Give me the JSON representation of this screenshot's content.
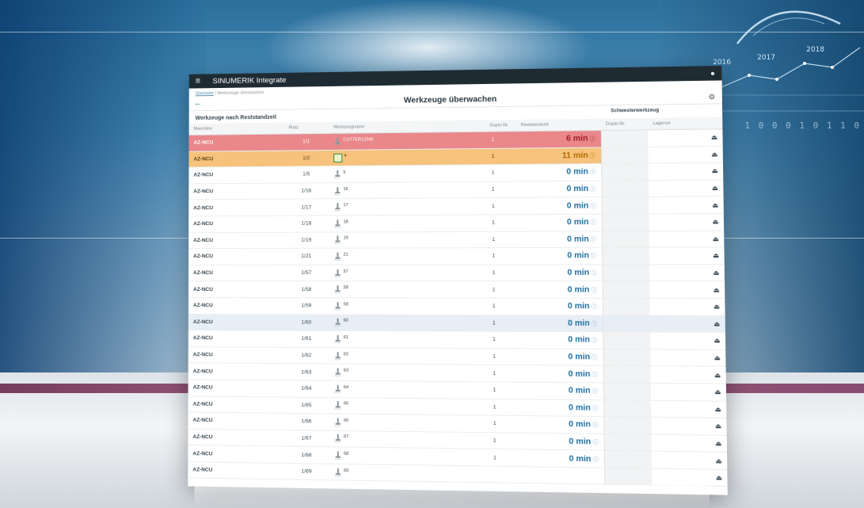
{
  "app": {
    "title": "SINUMERIK Integrate"
  },
  "breadcrumb": {
    "home": "Startseite",
    "separator": "|",
    "current": "Werkzeuge überwachen"
  },
  "page": {
    "title": "Werkzeuge überwachen"
  },
  "section": {
    "title": "Werkzeuge nach Reststandzeit",
    "sister_title": "Schwesterwerkzeug"
  },
  "columns": {
    "machine": "Maschine",
    "place": "Platz",
    "tool_name": "Werkzeugname",
    "duplo": "Duplo-Nr.",
    "rest": "Reststandzeit",
    "sister_duplo": "Duplo-Nr.",
    "location": "Lagerort"
  },
  "rows": [
    {
      "machine": "AZ-NCU",
      "place": "1/1",
      "tool": "CUTTER12345",
      "duplo": "1",
      "rest": "6 min",
      "status": "critical"
    },
    {
      "machine": "AZ-NCU",
      "place": "1/2",
      "tool": "4",
      "duplo": "1",
      "rest": "11 min",
      "status": "warning"
    },
    {
      "machine": "AZ-NCU",
      "place": "1/5",
      "tool": "5",
      "duplo": "1",
      "rest": "0 min",
      "status": "normal"
    },
    {
      "machine": "AZ-NCU",
      "place": "1/16",
      "tool": "16",
      "duplo": "1",
      "rest": "0 min",
      "status": "normal"
    },
    {
      "machine": "AZ-NCU",
      "place": "1/17",
      "tool": "17",
      "duplo": "1",
      "rest": "0 min",
      "status": "normal"
    },
    {
      "machine": "AZ-NCU",
      "place": "1/18",
      "tool": "18",
      "duplo": "1",
      "rest": "0 min",
      "status": "normal"
    },
    {
      "machine": "AZ-NCU",
      "place": "1/19",
      "tool": "19",
      "duplo": "1",
      "rest": "0 min",
      "status": "normal"
    },
    {
      "machine": "AZ-NCU",
      "place": "1/21",
      "tool": "21",
      "duplo": "1",
      "rest": "0 min",
      "status": "normal"
    },
    {
      "machine": "AZ-NCU",
      "place": "1/57",
      "tool": "57",
      "duplo": "1",
      "rest": "0 min",
      "status": "normal"
    },
    {
      "machine": "AZ-NCU",
      "place": "1/58",
      "tool": "58",
      "duplo": "1",
      "rest": "0 min",
      "status": "normal"
    },
    {
      "machine": "AZ-NCU",
      "place": "1/59",
      "tool": "59",
      "duplo": "1",
      "rest": "0 min",
      "status": "normal"
    },
    {
      "machine": "AZ-NCU",
      "place": "1/60",
      "tool": "60",
      "duplo": "1",
      "rest": "0 min",
      "status": "selected"
    },
    {
      "machine": "AZ-NCU",
      "place": "1/61",
      "tool": "61",
      "duplo": "1",
      "rest": "0 min",
      "status": "normal"
    },
    {
      "machine": "AZ-NCU",
      "place": "1/62",
      "tool": "62",
      "duplo": "1",
      "rest": "0 min",
      "status": "normal"
    },
    {
      "machine": "AZ-NCU",
      "place": "1/63",
      "tool": "63",
      "duplo": "1",
      "rest": "0 min",
      "status": "normal"
    },
    {
      "machine": "AZ-NCU",
      "place": "1/64",
      "tool": "64",
      "duplo": "1",
      "rest": "0 min",
      "status": "normal"
    },
    {
      "machine": "AZ-NCU",
      "place": "1/65",
      "tool": "65",
      "duplo": "1",
      "rest": "0 min",
      "status": "normal"
    },
    {
      "machine": "AZ-NCU",
      "place": "1/66",
      "tool": "66",
      "duplo": "1",
      "rest": "0 min",
      "status": "normal"
    },
    {
      "machine": "AZ-NCU",
      "place": "1/67",
      "tool": "67",
      "duplo": "1",
      "rest": "0 min",
      "status": "normal"
    },
    {
      "machine": "AZ-NCU",
      "place": "1/68",
      "tool": "68",
      "duplo": "1",
      "rest": "0 min",
      "status": "normal"
    },
    {
      "machine": "AZ-NCU",
      "place": "1/69",
      "tool": "69",
      "duplo": "",
      "rest": "",
      "status": "normal"
    }
  ],
  "background": {
    "years": [
      "2016",
      "2017",
      "2018"
    ],
    "digits": "1 0 0 0 1 0 1 1 0"
  },
  "colors": {
    "critical": "#e9878a",
    "warning": "#f6c27c",
    "accent": "#1e6fa1",
    "back": "#1e9a7c"
  },
  "icons": {
    "menu": "menu-icon",
    "user": "user-icon",
    "back": "back-arrow-icon",
    "settings": "gear-icon",
    "info": "info-icon",
    "location": "tray-icon",
    "tool": "milling-cutter-icon"
  }
}
